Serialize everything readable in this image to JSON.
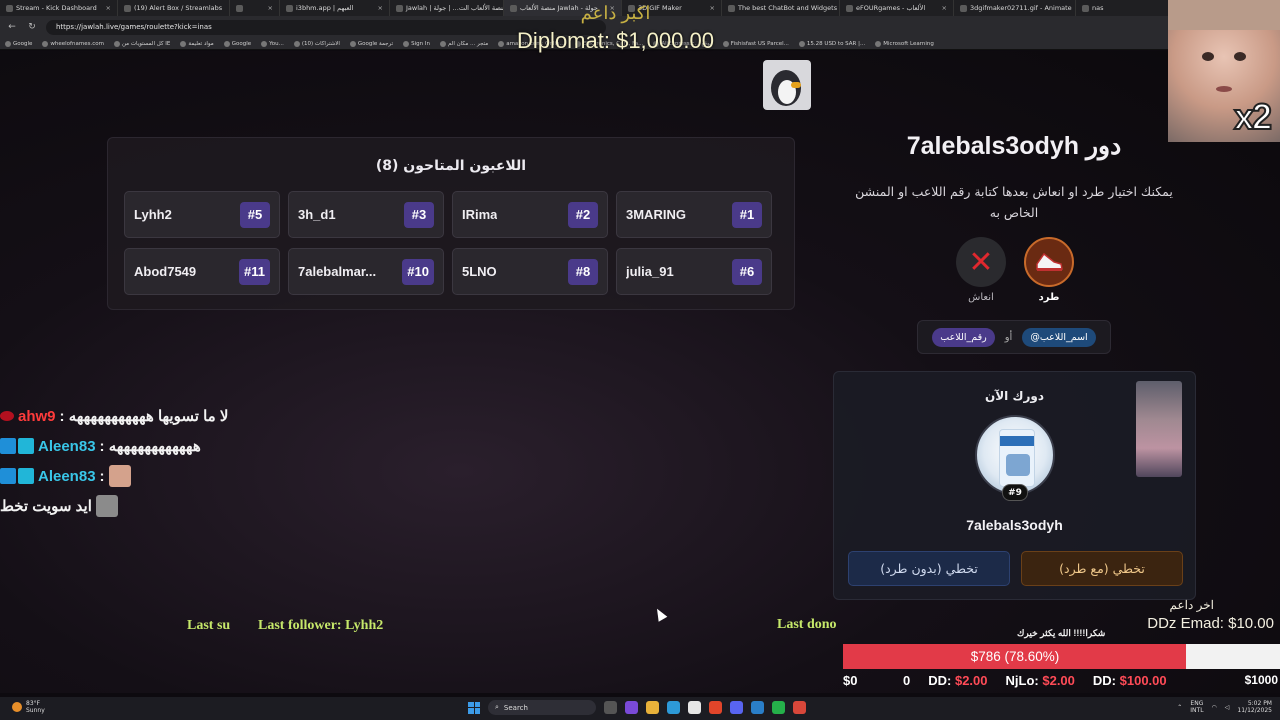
{
  "browser": {
    "tabs": [
      {
        "label": "Stream - Kick Dashboard",
        "w": 118
      },
      {
        "label": "(19) Alert Box / Streamlabs",
        "w": 112
      },
      {
        "label": "",
        "w": 50
      },
      {
        "label": "i3bhm.app | العبهم",
        "w": 110
      },
      {
        "label": "Jawlah | منصة الألعاب الت... | جولة",
        "w": 114,
        "active": false
      },
      {
        "label": "منصة الألعاب Jawlah - جولة",
        "w": 118,
        "active": true
      },
      {
        "label": "3D GIF Maker",
        "w": 100
      },
      {
        "label": "The best ChatBot and Widgets",
        "w": 118
      },
      {
        "label": "eFOURgames - الألعاب",
        "w": 114
      },
      {
        "label": "3dgifmaker02711.gif - Animate",
        "w": 122
      },
      {
        "label": "nas",
        "w": 104
      }
    ],
    "url": "https://jawlah.live/games/roulette?kick=inas",
    "bookmarks": [
      "Google",
      "wheelofnames.com",
      "كل المستويات من IE",
      "مواد تعليمة",
      "Google",
      "You...",
      "(10) الاشتراكات",
      "Google ترجمة",
      "Sign In",
      "متجر ... مكان الم",
      "amazon.com: Onlin...",
      "Electronics, Cars, Fa...",
      "AliExpress.c... موقع",
      "Fishisfast US Parcel...",
      "15.28 USD to SAR |...",
      "Microsoft Learning"
    ]
  },
  "donation_top": {
    "label": "اكبر داعم",
    "value": "Diplomat: $1,000.00"
  },
  "players": {
    "title": "اللاعبون المتاحون (8)",
    "list": [
      {
        "name": "Lyhh2",
        "num": "#5"
      },
      {
        "name": "3h_d1",
        "num": "#3"
      },
      {
        "name": "IRima",
        "num": "#2"
      },
      {
        "name": "3MARING",
        "num": "#1"
      },
      {
        "name": "Abod7549",
        "num": "#11"
      },
      {
        "name": "7alebalmar...",
        "num": "#10"
      },
      {
        "name": "5LNO",
        "num": "#8"
      },
      {
        "name": "julia_91",
        "num": "#6"
      }
    ]
  },
  "turn": {
    "title": "دور 7alebals3odyh",
    "description": "يمكنك اختيار طرد او انعاش بعدها كتابة رقم اللاعب او المنشن الخاص به",
    "revive_label": "انعاش",
    "kick_label": "طرد",
    "format_at": "@اسم_اللاعب",
    "format_or": "أو",
    "format_num": "رقم_اللاعب"
  },
  "current": {
    "title": "دورك الآن",
    "number": "#9",
    "name": "7alebals3odyh",
    "skip_no_kick": "تخطي (بدون طرد)",
    "skip_with_kick": "تخطي (مع طرد)"
  },
  "chat": [
    {
      "user": "ahw9",
      "color": "red",
      "msg": ": لا ما تسويها هههههههههههه",
      "badges": [
        "mic"
      ],
      "emote": false
    },
    {
      "user": "Aleen83",
      "color": "blue",
      "msg": ": ههههههههههههه",
      "badges": [
        "a",
        "b"
      ],
      "emote": false
    },
    {
      "user": "Aleen83",
      "color": "blue",
      "msg": ":",
      "badges": [
        "a",
        "b"
      ],
      "emote": true
    },
    {
      "user": "",
      "color": "blue",
      "msg": "ايد سويت تخط",
      "badges": [],
      "emote": true
    }
  ],
  "overlay": {
    "cam_multiplier": "x2",
    "last_sub": "Last su",
    "last_follower": "Last follower: Lyhh2",
    "last_donor": "Last dono",
    "last_donation_title": "اخر داعم",
    "last_donation_value": "DDz Emad: $10.00",
    "thanks": "شكرا!!!! الله يكثر خيرك",
    "goal_text": "$786 (78.60%)",
    "goal_fraction": 0.786,
    "goal_min": "$0",
    "goal_max": "$1000",
    "donors": [
      {
        "name": "0",
        "amount": ""
      },
      {
        "name": "DD:",
        "amount": "$2.00"
      },
      {
        "name": "NjLo:",
        "amount": "$2.00"
      },
      {
        "name": "DD:",
        "amount": "$100.00"
      }
    ]
  },
  "taskbar": {
    "temp": "83°F",
    "weather": "Sunny",
    "search": "Search",
    "lang1": "ENG",
    "lang2": "INTL",
    "time": "5:02 PM",
    "date": "11/12/2025"
  }
}
